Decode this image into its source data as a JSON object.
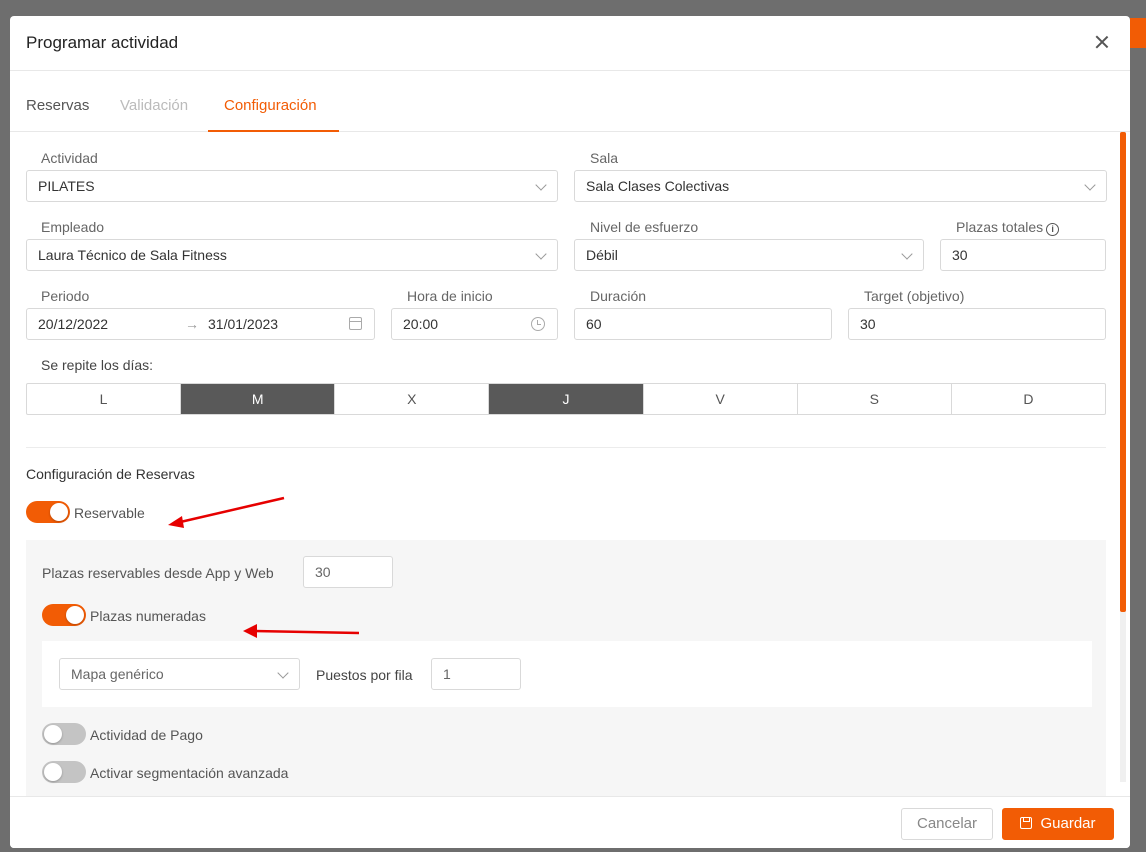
{
  "modal": {
    "title": "Programar actividad"
  },
  "tabs": [
    {
      "label": "Reservas",
      "state": "normal"
    },
    {
      "label": "Validación",
      "state": "disabled"
    },
    {
      "label": "Configuración",
      "state": "active"
    }
  ],
  "form": {
    "actividad": {
      "label": "Actividad",
      "value": "PILATES"
    },
    "sala": {
      "label": "Sala",
      "value": "Sala Clases Colectivas"
    },
    "empleado": {
      "label": "Empleado",
      "value": "Laura Técnico de Sala Fitness"
    },
    "nivel": {
      "label": "Nivel de esfuerzo",
      "value": "Débil"
    },
    "plazas": {
      "label": "Plazas totales",
      "value": "30"
    },
    "periodo": {
      "label": "Periodo",
      "start": "20/12/2022",
      "end": "31/01/2023",
      "separator": "→"
    },
    "hora": {
      "label": "Hora de inicio",
      "value": "20:00"
    },
    "duracion": {
      "label": "Duración",
      "value": "60"
    },
    "target": {
      "label": "Target (objetivo)",
      "value": "30"
    },
    "dias": {
      "label": "Se repite los días:",
      "items": [
        {
          "label": "L",
          "selected": false
        },
        {
          "label": "M",
          "selected": true
        },
        {
          "label": "X",
          "selected": false
        },
        {
          "label": "J",
          "selected": true
        },
        {
          "label": "V",
          "selected": false
        },
        {
          "label": "S",
          "selected": false
        },
        {
          "label": "D",
          "selected": false
        }
      ]
    }
  },
  "reservas": {
    "section_title": "Configuración de Reservas",
    "reservable": {
      "label": "Reservable",
      "on": true
    },
    "plazas_app_web": {
      "label": "Plazas reservables desde App y Web",
      "value": "30"
    },
    "plazas_numeradas": {
      "label": "Plazas numeradas",
      "on": true
    },
    "mapa": {
      "value": "Mapa genérico"
    },
    "puestos_fila": {
      "label": "Puestos por fila",
      "value": "1"
    },
    "actividad_pago": {
      "label": "Actividad de Pago",
      "on": false
    },
    "segmentacion": {
      "label": "Activar segmentación avanzada",
      "on": false
    }
  },
  "footer": {
    "cancel_label": "Cancelar",
    "save_label": "Guardar"
  },
  "colors": {
    "accent": "#f25c05",
    "day_selected": "#595959",
    "annotation_arrow": "#e60000"
  }
}
